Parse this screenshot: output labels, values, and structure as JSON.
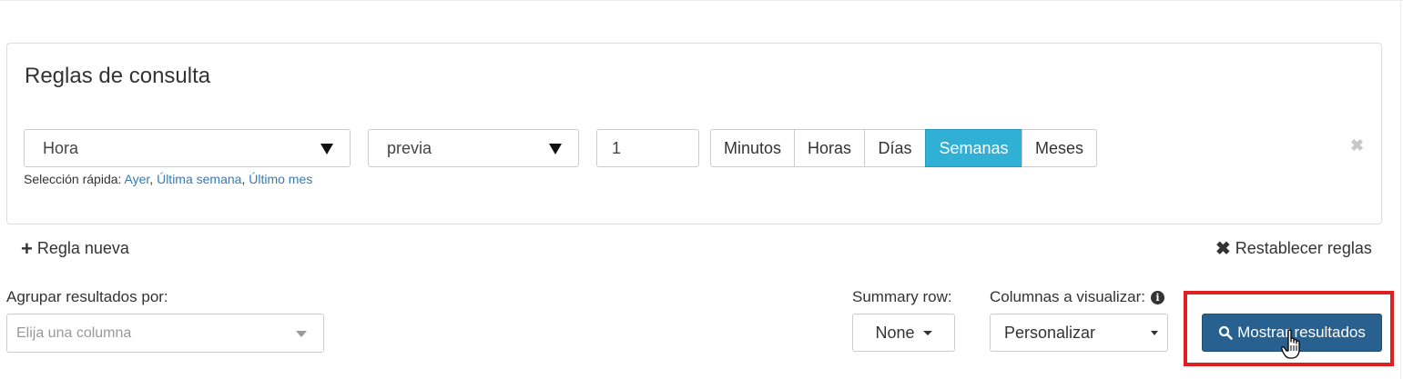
{
  "panel": {
    "title": "Reglas de consulta",
    "rule": {
      "field": "Hora",
      "operator": "previa",
      "value": "1",
      "units": [
        "Minutos",
        "Horas",
        "Días",
        "Semanas",
        "Meses"
      ],
      "active_unit": "Semanas",
      "remove_icon": "close-icon"
    },
    "quick": {
      "label": "Selección rápida:",
      "links": [
        "Ayer",
        "Última semana",
        "Último mes"
      ]
    }
  },
  "actions": {
    "add_rule": "Regla nueva",
    "reset_rules": "Restablecer reglas"
  },
  "controls": {
    "group_label": "Agrupar resultados por:",
    "group_placeholder": "Elija una columna",
    "summary_label": "Summary row:",
    "summary_value": "None",
    "columns_label": "Columnas a visualizar:",
    "columns_value": "Personalizar",
    "show_button": "Mostrar resultados"
  },
  "colors": {
    "active_unit_bg": "#31b0d5",
    "primary_button_bg": "#286090",
    "link": "#337ab7",
    "highlight_border": "#e02020"
  }
}
